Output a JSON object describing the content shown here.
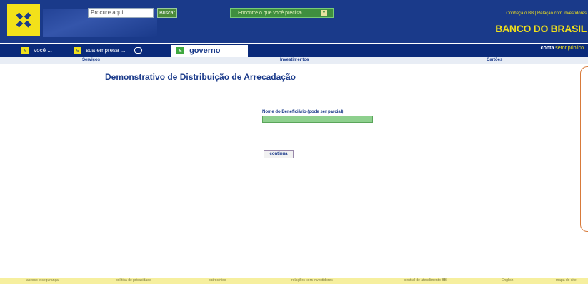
{
  "header": {
    "search_placeholder": "Procure aqui...",
    "search_button": "Buscar",
    "encontre_label": "Encontre o que você precisa...",
    "top_links": "Conheça o BB  |  Relação com Investidores",
    "brand_name": "Banco do Brasil"
  },
  "nav": {
    "tabs": [
      {
        "label": "você ..."
      },
      {
        "label": "sua empresa ..."
      },
      {
        "label": "governo"
      }
    ],
    "conta_prefix": "conta",
    "conta_highlight": "setor público"
  },
  "menu": {
    "items": [
      "Serviços",
      "Investimentos",
      "Cartões"
    ]
  },
  "page": {
    "title": "Demonstrativo de Distribuição de Arrecadação",
    "field_label": "Nome do Beneficiário (pode ser parcial):",
    "field_value": "",
    "continue_button": "continua"
  },
  "footer": {
    "items": [
      "acesso e segurança",
      "política de privacidade",
      "patrocínios",
      "relações com investidores",
      "central de atendimento BB",
      "English",
      "mapa do site"
    ]
  },
  "colors": {
    "brand_blue": "#1a3a8a",
    "brand_yellow": "#f2e11a",
    "input_green": "#8ed08e"
  }
}
